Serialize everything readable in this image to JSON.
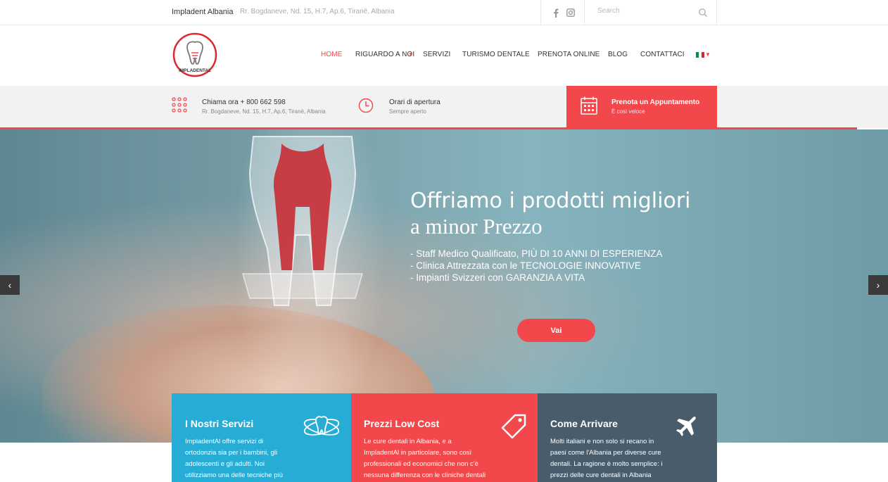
{
  "topbar": {
    "brand": "Impladent Albania",
    "address": "Rr. Bogdaneve, Nd. 15, H.7, Ap.6, Tiranë, Albania",
    "search_placeholder": "Search"
  },
  "logo": {
    "text": "IMPLADENTAL"
  },
  "nav": {
    "items": [
      "HOME",
      "RIGUARDO A NOI",
      "SERVIZI",
      "TURISMO DENTALE",
      "PRENOTA ONLINE",
      "BLOG",
      "CONTATTACI"
    ],
    "active": "HOME",
    "language": "Italiano"
  },
  "info": {
    "phone_title": "Chiama ora + 800 662 598",
    "phone_sub": "Rr. Bogdaneve, Nd. 15, H.7, Ap.6, Tiranë, Albania",
    "hours_title": "Orari di apertura",
    "hours_sub": "Sempre aperto",
    "appt_title": "Prenota un Appuntamento",
    "appt_sub": "È così veloce"
  },
  "hero": {
    "title_line1": "Offriamo i prodotti migliori",
    "title_line2": "a minor Prezzo",
    "bullets": [
      "- Staff Medico Qualificato, PIÙ DI 10 ANNI DI ESPERIENZA",
      "- Clinica Attrezzata con le TECNOLOGIE INNOVATIVE",
      "- Impianti Svizzeri con GARANZIA A VITA"
    ],
    "button": "Vai",
    "prev": "‹",
    "next": "›"
  },
  "boxes": [
    {
      "title": "I Nostri Servizi",
      "lines": [
        "ImpladentAl offre servizi di",
        "ortodonzia sia per i bambini, gli",
        "adolescenti e gli adulti. Noi",
        "utilizziamo una delle tecniche più"
      ],
      "color": "#27acd6"
    },
    {
      "title": "Prezzi Low Cost",
      "lines": [
        "Le cure dentali in Albania, e a",
        "ImpladentAl in particolare, sono così",
        "professionali ed economici che non c'è",
        "nessuna differenza con le cliniche dentali"
      ],
      "color": "#f2484b"
    },
    {
      "title": "Come Arrivare",
      "lines": [
        "Molti italiani e non solo si recano in",
        "paesi come l'Albania per diverse cure",
        "dentali. La ragione è molto semplice: i",
        "prezzi delle cure dentali in Albania"
      ],
      "color": "#485c6c"
    }
  ],
  "colors": {
    "accent": "#f2484b",
    "blue": "#27acd6",
    "slate": "#485c6c"
  }
}
